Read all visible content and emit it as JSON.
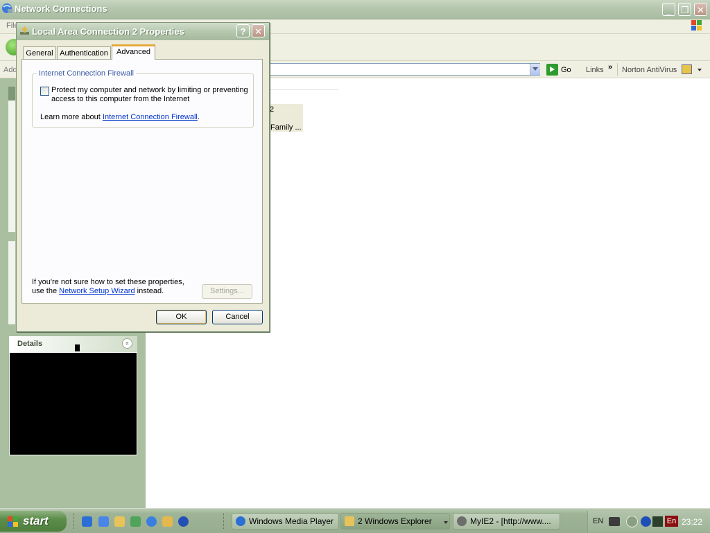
{
  "explorer": {
    "title": "Network Connections",
    "menu_file": "File",
    "address_label": "Address",
    "go_label": "Go",
    "links_label": "Links",
    "links_chevron": "»",
    "norton_label": "Norton AntiVirus",
    "details_title": "Details",
    "details_collapse": "«",
    "bg_text1": "2",
    "bg_text2": "Family ..."
  },
  "window_buttons": {
    "minimize": "_",
    "restore": "❐",
    "close": "✕"
  },
  "dialog": {
    "title": "Local Area Connection 2 Properties",
    "help_label": "?",
    "close_label": "✕",
    "tabs": [
      {
        "label": "General"
      },
      {
        "label": "Authentication"
      },
      {
        "label": "Advanced",
        "active": true
      }
    ],
    "firewall_group": "Internet Connection Firewall",
    "firewall_checkbox_label": "Protect my computer and network by limiting or preventing access to this computer from the Internet",
    "firewall_checked": false,
    "learn_more_prefix": "Learn more about ",
    "learn_more_link": "Internet Connection Firewall",
    "learn_more_suffix": ".",
    "note_prefix": "If you're not sure how to set these properties, use the ",
    "note_link": "Network Setup Wizard",
    "note_suffix": " instead.",
    "settings_button": "Settings...",
    "ok_button": "OK",
    "cancel_button": "Cancel"
  },
  "taskbar": {
    "start_label": "start",
    "tasks": [
      {
        "label": "Windows Media Player"
      },
      {
        "label": "2 Windows Explorer",
        "active": true
      },
      {
        "label": "MyIE2 - [http://www...."
      }
    ],
    "tray_lang": "EN",
    "tray_en": "En",
    "clock": "23:22"
  },
  "colors": {
    "accent": "#e5a93c",
    "link": "#0033cc",
    "titlebar": "#b6c8b0",
    "dialog_bg": "#ecead8"
  }
}
